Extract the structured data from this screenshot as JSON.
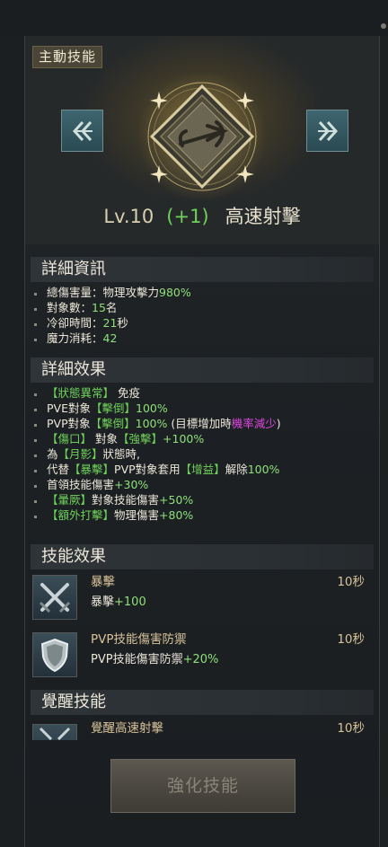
{
  "skill": {
    "category_tag": "主動技能",
    "level": "Lv.10",
    "bonus": "(+1)",
    "name": "高速射擊"
  },
  "details": {
    "title": "詳細資訊",
    "lines": [
      {
        "label": "總傷害量：物理攻擊力",
        "value": "980%"
      },
      {
        "label": "對象數：",
        "value": "15",
        "suffix": "名"
      },
      {
        "label": "冷卻時間：",
        "value": "21",
        "suffix": "秒"
      },
      {
        "label": "魔力消耗：",
        "value": "42"
      }
    ]
  },
  "detail_effects": {
    "title": "詳細效果",
    "lines": [
      {
        "parts": [
          {
            "t": "【狀態異常】",
            "c": "br"
          },
          {
            "t": " 免疫",
            "c": ""
          }
        ]
      },
      {
        "parts": [
          {
            "t": "PVE對象",
            "c": ""
          },
          {
            "t": "【擊倒】",
            "c": "br"
          },
          {
            "t": "100%",
            "c": "g"
          }
        ]
      },
      {
        "parts": [
          {
            "t": "PVP對象",
            "c": ""
          },
          {
            "t": "【擊倒】",
            "c": "br"
          },
          {
            "t": "100%",
            "c": "g"
          },
          {
            "t": " (目標增加時",
            "c": ""
          },
          {
            "t": "機率減少",
            "c": "m"
          },
          {
            "t": ")",
            "c": ""
          }
        ]
      },
      {
        "parts": [
          {
            "t": "【傷口】",
            "c": "br"
          },
          {
            "t": " 對象",
            "c": ""
          },
          {
            "t": "【強擊】",
            "c": "br"
          },
          {
            "t": "+100%",
            "c": "g"
          }
        ]
      },
      {
        "parts": [
          {
            "t": "為",
            "c": ""
          },
          {
            "t": "【月影】",
            "c": "br"
          },
          {
            "t": "狀態時,",
            "c": ""
          }
        ]
      },
      {
        "parts": [
          {
            "t": "代替",
            "c": ""
          },
          {
            "t": "【暴擊】",
            "c": "br"
          },
          {
            "t": "PVP對象套用",
            "c": ""
          },
          {
            "t": "【增益】",
            "c": "br"
          },
          {
            "t": "解除",
            "c": ""
          },
          {
            "t": "100%",
            "c": "g"
          }
        ]
      },
      {
        "parts": [
          {
            "t": "首領技能傷害",
            "c": ""
          },
          {
            "t": "+30%",
            "c": "g"
          }
        ]
      },
      {
        "parts": [
          {
            "t": "【暈厥】",
            "c": "br"
          },
          {
            "t": "對象技能傷害",
            "c": ""
          },
          {
            "t": "+50%",
            "c": "g"
          }
        ]
      },
      {
        "parts": [
          {
            "t": "【額外打擊】",
            "c": "br"
          },
          {
            "t": "物理傷害",
            "c": ""
          },
          {
            "t": "+80%",
            "c": "g"
          }
        ]
      }
    ]
  },
  "skill_effects": {
    "title": "技能效果",
    "items": [
      {
        "name": "暴擊",
        "desc": "暴擊",
        "value": "+100",
        "time": "10秒",
        "icon": "crossed-swords-icon"
      },
      {
        "name": "PVP技能傷害防禦",
        "desc": "PVP技能傷害防禦",
        "value": "+20%",
        "time": "10秒",
        "icon": "shield-icon"
      }
    ]
  },
  "awaken": {
    "title": "覺醒技能",
    "item": {
      "name": "覺醒高速射擊",
      "time": "10秒",
      "icon": "awaken-arrows-icon"
    }
  },
  "enhance_button": "強化技能",
  "colors": {
    "green": "#8fe07a",
    "bracket_green": "#6fd15a",
    "magenta": "#e048e0",
    "gold": "#d7c39a"
  }
}
